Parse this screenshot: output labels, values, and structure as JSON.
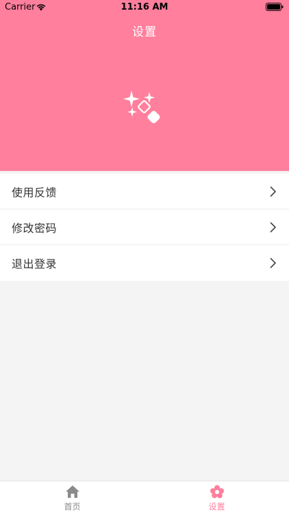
{
  "status_bar": {
    "carrier": "Carrier",
    "time": "11:16 AM"
  },
  "header": {
    "title": "设置",
    "background_color": "#ff7f9d",
    "icon": "sparkle-icon"
  },
  "menu": {
    "items": [
      {
        "label": "使用反馈",
        "icon": "chevron-right-icon"
      },
      {
        "label": "修改密码",
        "icon": "chevron-right-icon"
      },
      {
        "label": "退出登录",
        "icon": "chevron-right-icon"
      }
    ]
  },
  "tab_bar": {
    "tabs": [
      {
        "label": "首页",
        "icon": "home-icon",
        "active": false,
        "color": "#8a8a8a"
      },
      {
        "label": "设置",
        "icon": "flower-icon",
        "active": true,
        "color": "#ff7f9d"
      }
    ]
  },
  "colors": {
    "accent": "#ff7f9d",
    "background": "#f4f4f4",
    "text": "#333333"
  }
}
